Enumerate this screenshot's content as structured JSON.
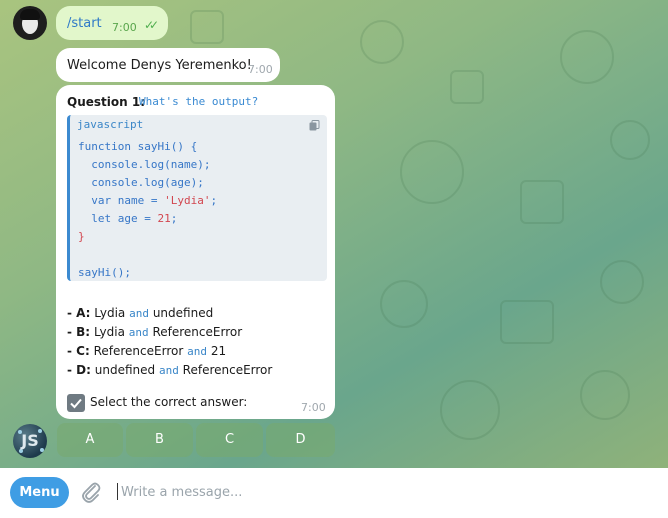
{
  "chat": {
    "user_message": {
      "text": "/start",
      "time": "7:00",
      "ticks": "✓✓"
    },
    "welcome": {
      "text": "Welcome Denys Yeremenko!",
      "time": "7:00"
    },
    "question": {
      "label": "Question 1:",
      "subtitle": "What's the output?",
      "code_lang": "javascript",
      "options": [
        {
          "key": "- A:",
          "left": "Lydia",
          "and": "and",
          "right": "undefined"
        },
        {
          "key": "- B:",
          "left": "Lydia",
          "and": "and",
          "right": "ReferenceError"
        },
        {
          "key": "- C:",
          "left": "ReferenceError",
          "and": "and",
          "right": "21"
        },
        {
          "key": "- D:",
          "left": "undefined",
          "and": "and",
          "right": "ReferenceError"
        }
      ],
      "prompt": "Select the correct answer:",
      "time": "7:00"
    },
    "bot_avatar": "JS",
    "keyboard": [
      "A",
      "B",
      "C",
      "D"
    ]
  },
  "composer": {
    "menu_label": "Menu",
    "placeholder": "Write a message..."
  },
  "code": {
    "l1_kw": "function",
    "l1_fn": "sayHi",
    "l1_rest": "() {",
    "l2": "  console.log(name);",
    "l3": "  console.log(age);",
    "l4_kw": "  var",
    "l4_mid": " name = ",
    "l4_str": "'Lydia'",
    "l4_end": ";",
    "l5_kw": "  let",
    "l5_mid": " age = ",
    "l5_num": "21",
    "l5_end": ";",
    "l6": "}",
    "l8": "sayHi();"
  },
  "colors": {
    "accent": "#3f9de4",
    "outgoing_bubble": "#e2f7cb",
    "code_accent": "#3c8ad0"
  }
}
